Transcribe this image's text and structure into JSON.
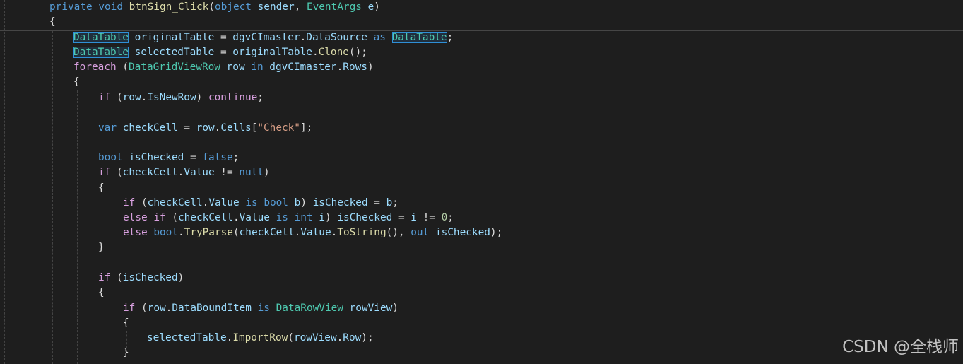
{
  "colors": {
    "background": "#1e1e1e",
    "keyword": "#569cd6",
    "control": "#d8a0df",
    "type": "#4ec9b0",
    "string": "#d69d85",
    "number": "#b5cea8",
    "method": "#dcdcaa",
    "variable": "#9cdcfe",
    "plain": "#dcdcdc"
  },
  "code_lines": [
    [
      [
        "kw",
        "private"
      ],
      [
        "pl",
        " "
      ],
      [
        "kw",
        "void"
      ],
      [
        "pl",
        " "
      ],
      [
        "fn",
        "btnSign_Click"
      ],
      [
        "pl",
        "("
      ],
      [
        "kw",
        "object"
      ],
      [
        "pl",
        " "
      ],
      [
        "var",
        "sender"
      ],
      [
        "pl",
        ", "
      ],
      [
        "typ",
        "EventArgs"
      ],
      [
        "pl",
        " "
      ],
      [
        "var",
        "e"
      ],
      [
        "pl",
        ")"
      ]
    ],
    [
      [
        "pl",
        "{"
      ]
    ],
    [
      [
        "typ",
        "DataTable"
      ],
      [
        "pl",
        " "
      ],
      [
        "var",
        "originalTable"
      ],
      [
        "pl",
        " = "
      ],
      [
        "var",
        "dgvCImaster"
      ],
      [
        "pl",
        "."
      ],
      [
        "var",
        "DataSource"
      ],
      [
        "pl",
        " "
      ],
      [
        "kw",
        "as"
      ],
      [
        "pl",
        " "
      ],
      [
        "typ",
        "DataTable"
      ],
      [
        "pl",
        ";"
      ]
    ],
    [
      [
        "typ",
        "DataTable"
      ],
      [
        "pl",
        " "
      ],
      [
        "var",
        "selectedTable"
      ],
      [
        "pl",
        " = "
      ],
      [
        "var",
        "originalTable"
      ],
      [
        "pl",
        "."
      ],
      [
        "fn",
        "Clone"
      ],
      [
        "pl",
        "();"
      ]
    ],
    [
      [
        "ctl",
        "foreach"
      ],
      [
        "pl",
        " ("
      ],
      [
        "typ",
        "DataGridViewRow"
      ],
      [
        "pl",
        " "
      ],
      [
        "var",
        "row"
      ],
      [
        "pl",
        " "
      ],
      [
        "kw",
        "in"
      ],
      [
        "pl",
        " "
      ],
      [
        "var",
        "dgvCImaster"
      ],
      [
        "pl",
        "."
      ],
      [
        "var",
        "Rows"
      ],
      [
        "pl",
        ")"
      ]
    ],
    [
      [
        "pl",
        "{"
      ]
    ],
    [
      [
        "ctl",
        "if"
      ],
      [
        "pl",
        " ("
      ],
      [
        "var",
        "row"
      ],
      [
        "pl",
        "."
      ],
      [
        "var",
        "IsNewRow"
      ],
      [
        "pl",
        ") "
      ],
      [
        "ctl",
        "continue"
      ],
      [
        "pl",
        ";"
      ]
    ],
    [],
    [
      [
        "kw",
        "var"
      ],
      [
        "pl",
        " "
      ],
      [
        "var",
        "checkCell"
      ],
      [
        "pl",
        " = "
      ],
      [
        "var",
        "row"
      ],
      [
        "pl",
        "."
      ],
      [
        "var",
        "Cells"
      ],
      [
        "pl",
        "["
      ],
      [
        "str",
        "\"Check\""
      ],
      [
        "pl",
        "];"
      ]
    ],
    [],
    [
      [
        "kw",
        "bool"
      ],
      [
        "pl",
        " "
      ],
      [
        "var",
        "isChecked"
      ],
      [
        "pl",
        " = "
      ],
      [
        "kw",
        "false"
      ],
      [
        "pl",
        ";"
      ]
    ],
    [
      [
        "ctl",
        "if"
      ],
      [
        "pl",
        " ("
      ],
      [
        "var",
        "checkCell"
      ],
      [
        "pl",
        "."
      ],
      [
        "var",
        "Value"
      ],
      [
        "pl",
        " != "
      ],
      [
        "kw",
        "null"
      ],
      [
        "pl",
        ")"
      ]
    ],
    [
      [
        "pl",
        "{"
      ]
    ],
    [
      [
        "ctl",
        "if"
      ],
      [
        "pl",
        " ("
      ],
      [
        "var",
        "checkCell"
      ],
      [
        "pl",
        "."
      ],
      [
        "var",
        "Value"
      ],
      [
        "pl",
        " "
      ],
      [
        "kw",
        "is"
      ],
      [
        "pl",
        " "
      ],
      [
        "kw",
        "bool"
      ],
      [
        "pl",
        " "
      ],
      [
        "var",
        "b"
      ],
      [
        "pl",
        ") "
      ],
      [
        "var",
        "isChecked"
      ],
      [
        "pl",
        " = "
      ],
      [
        "var",
        "b"
      ],
      [
        "pl",
        ";"
      ]
    ],
    [
      [
        "ctl",
        "else"
      ],
      [
        "pl",
        " "
      ],
      [
        "ctl",
        "if"
      ],
      [
        "pl",
        " ("
      ],
      [
        "var",
        "checkCell"
      ],
      [
        "pl",
        "."
      ],
      [
        "var",
        "Value"
      ],
      [
        "pl",
        " "
      ],
      [
        "kw",
        "is"
      ],
      [
        "pl",
        " "
      ],
      [
        "kw",
        "int"
      ],
      [
        "pl",
        " "
      ],
      [
        "var",
        "i"
      ],
      [
        "pl",
        ") "
      ],
      [
        "var",
        "isChecked"
      ],
      [
        "pl",
        " = "
      ],
      [
        "var",
        "i"
      ],
      [
        "pl",
        " != "
      ],
      [
        "num",
        "0"
      ],
      [
        "pl",
        ";"
      ]
    ],
    [
      [
        "ctl",
        "else"
      ],
      [
        "pl",
        " "
      ],
      [
        "kw",
        "bool"
      ],
      [
        "pl",
        "."
      ],
      [
        "fn",
        "TryParse"
      ],
      [
        "pl",
        "("
      ],
      [
        "var",
        "checkCell"
      ],
      [
        "pl",
        "."
      ],
      [
        "var",
        "Value"
      ],
      [
        "pl",
        "."
      ],
      [
        "fn",
        "ToString"
      ],
      [
        "pl",
        "(), "
      ],
      [
        "kw",
        "out"
      ],
      [
        "pl",
        " "
      ],
      [
        "var",
        "isChecked"
      ],
      [
        "pl",
        ");"
      ]
    ],
    [
      [
        "pl",
        "}"
      ]
    ],
    [],
    [
      [
        "ctl",
        "if"
      ],
      [
        "pl",
        " ("
      ],
      [
        "var",
        "isChecked"
      ],
      [
        "pl",
        ")"
      ]
    ],
    [
      [
        "pl",
        "{"
      ]
    ],
    [
      [
        "ctl",
        "if"
      ],
      [
        "pl",
        " ("
      ],
      [
        "var",
        "row"
      ],
      [
        "pl",
        "."
      ],
      [
        "var",
        "DataBoundItem"
      ],
      [
        "pl",
        " "
      ],
      [
        "kw",
        "is"
      ],
      [
        "pl",
        " "
      ],
      [
        "typ",
        "DataRowView"
      ],
      [
        "pl",
        " "
      ],
      [
        "var",
        "rowView"
      ],
      [
        "pl",
        ")"
      ]
    ],
    [
      [
        "pl",
        "{"
      ]
    ],
    [
      [
        "var",
        "selectedTable"
      ],
      [
        "pl",
        "."
      ],
      [
        "fn",
        "ImportRow"
      ],
      [
        "pl",
        "("
      ],
      [
        "var",
        "rowView"
      ],
      [
        "pl",
        "."
      ],
      [
        "var",
        "Row"
      ],
      [
        "pl",
        ");"
      ]
    ],
    [
      [
        "pl",
        "}"
      ]
    ]
  ],
  "watermark": "CSDN @全栈师"
}
